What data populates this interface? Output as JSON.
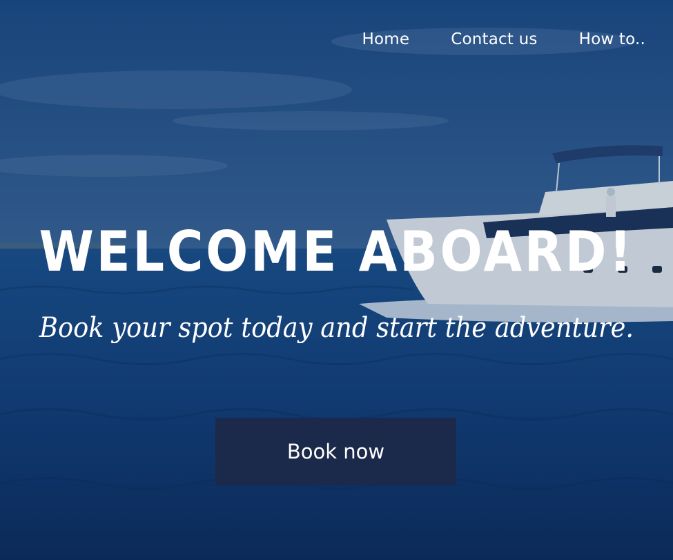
{
  "nav": {
    "items": [
      {
        "label": "Home"
      },
      {
        "label": "Contact us"
      },
      {
        "label": "How to.."
      }
    ]
  },
  "hero": {
    "title": "WELCOME ABOARD!",
    "subtitle": "Book your spot today and start the adventure.",
    "cta_label": "Book now"
  },
  "colors": {
    "overlay": "#123766",
    "button_bg": "#1b2a4a",
    "text": "#ffffff"
  }
}
